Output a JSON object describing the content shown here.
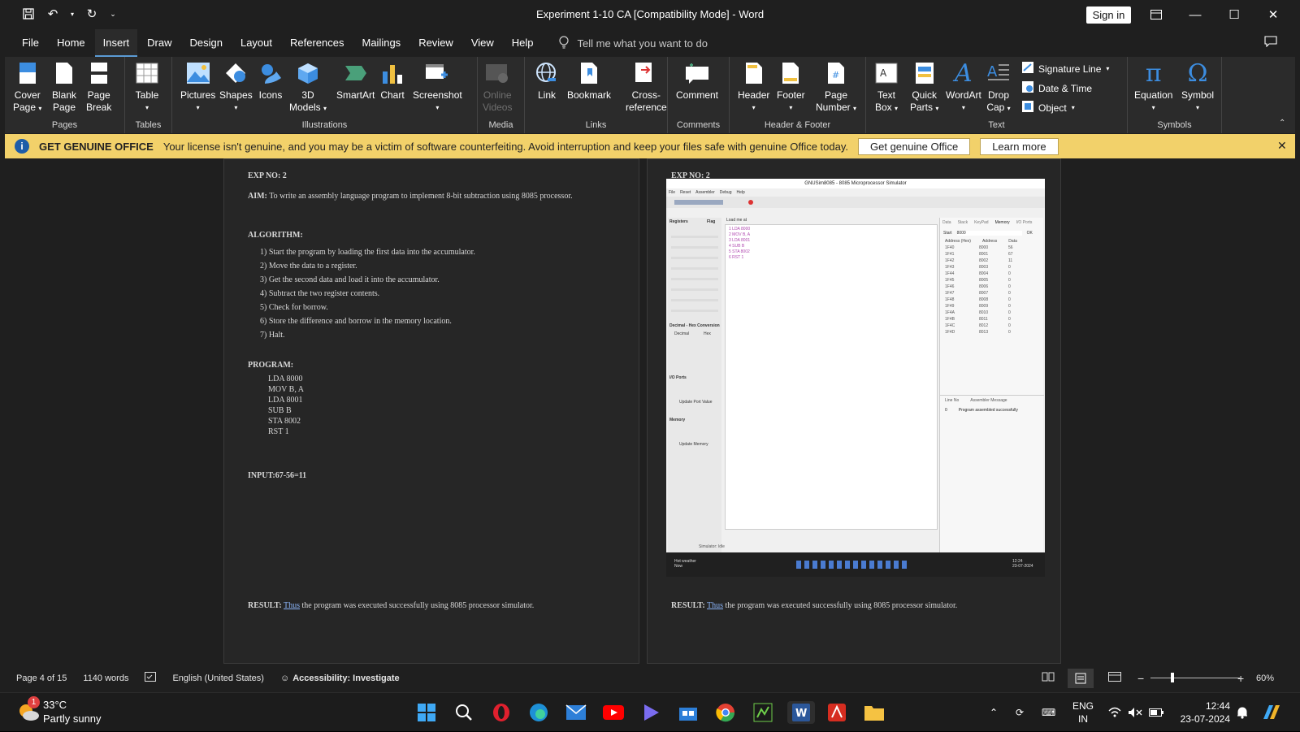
{
  "window": {
    "title": "Experiment 1-10 CA [Compatibility Mode]  -  Word",
    "sign_in": "Sign in"
  },
  "menu": {
    "tabs": [
      "File",
      "Home",
      "Insert",
      "Draw",
      "Design",
      "Layout",
      "References",
      "Mailings",
      "Review",
      "View",
      "Help"
    ],
    "active": "Insert",
    "tell_me": "Tell me what you want to do"
  },
  "ribbon": {
    "pages": {
      "label": "Pages",
      "cover": "Cover",
      "cover2": "Page",
      "blank": "Blank",
      "blank2": "Page",
      "break": "Page",
      "break2": "Break"
    },
    "tables": {
      "label": "Tables",
      "table": "Table"
    },
    "illustrations": {
      "label": "Illustrations",
      "pictures": "Pictures",
      "shapes": "Shapes",
      "icons": "Icons",
      "models": "3D",
      "models2": "Models",
      "smartart": "SmartArt",
      "chart": "Chart",
      "screenshot": "Screenshot"
    },
    "media": {
      "label": "Media",
      "online": "Online",
      "online2": "Videos"
    },
    "links": {
      "label": "Links",
      "link": "Link",
      "bookmark": "Bookmark",
      "cross": "Cross-",
      "cross2": "reference"
    },
    "comments": {
      "label": "Comments",
      "comment": "Comment"
    },
    "headerfooter": {
      "label": "Header & Footer",
      "header": "Header",
      "footer": "Footer",
      "pagenum": "Page",
      "pagenum2": "Number"
    },
    "text": {
      "label": "Text",
      "textbox": "Text",
      "textbox2": "Box",
      "quickparts": "Quick",
      "quickparts2": "Parts",
      "wordart": "WordArt",
      "dropcap": "Drop",
      "dropcap2": "Cap",
      "sigline": "Signature Line",
      "datetime": "Date & Time",
      "object": "Object"
    },
    "symbols": {
      "label": "Symbols",
      "equation": "Equation",
      "symbol": "Symbol"
    }
  },
  "infobar": {
    "title": "GET GENUINE OFFICE",
    "message": "Your license isn't genuine, and you may be a victim of software counterfeiting. Avoid interruption and keep your files safe with genuine Office today.",
    "btn_get": "Get genuine Office",
    "btn_learn": "Learn more"
  },
  "doc_left": {
    "exp": "EXP NO: 2",
    "aim_label": "AIM:",
    "aim": " To write an assembly language program to implement 8-bit subtraction using 8085 processor.",
    "algo_label": "ALGORITHM:",
    "steps": [
      "1)    Start the program by loading the first data into the accumulator.",
      "2)    Move the data to a register.",
      "3)    Get the second data and load it into the accumulator.",
      "4)    Subtract the two register contents.",
      "5)    Check for borrow.",
      "6)    Store the difference and borrow in the memory location.",
      "7)    Halt."
    ],
    "program_label": "PROGRAM:",
    "program": [
      "LDA 8000",
      "MOV B, A",
      "LDA 8001",
      "SUB B",
      "STA 8002",
      "RST 1"
    ],
    "input": "INPUT:67-56=11",
    "result_label": "RESULT:",
    "result_link": "Thus",
    "result": " the program was executed successfully using 8085 processor simulator."
  },
  "doc_right": {
    "exp": "EXP NO: 2",
    "result_label": "RESULT:",
    "result_link": "Thus",
    "result": " the program was executed successfully using 8085 processor simulator."
  },
  "sim": {
    "title": "GNUSim8085 - 8085 Microprocessor Simulator",
    "menu": [
      "File",
      "Reset",
      "Assembler",
      "Debug",
      "Help"
    ],
    "registers": "Registers",
    "flag": "Flag",
    "load_me_at": "Load me at",
    "code": [
      "1   LDA 8000",
      "2   MOV B, A",
      "3   LDA 8001",
      "4   SUB B",
      "5   STA 8002",
      "6   RST 1"
    ],
    "tabs": [
      "Data",
      "Stack",
      "KeyPad",
      "Memory",
      "I/O Ports"
    ],
    "start": "Start",
    "start_val": "8000",
    "ok": "OK",
    "mem_headers": [
      "Address (Hex)",
      "Address",
      "Data"
    ],
    "mem_rows": [
      [
        "1F40",
        "8000",
        "56"
      ],
      [
        "1F41",
        "8001",
        "67"
      ],
      [
        "1F42",
        "8002",
        "11"
      ],
      [
        "1F43",
        "8003",
        "0"
      ],
      [
        "1F44",
        "8004",
        "0"
      ],
      [
        "1F45",
        "8005",
        "0"
      ],
      [
        "1F46",
        "8006",
        "0"
      ],
      [
        "1F47",
        "8007",
        "0"
      ],
      [
        "1F48",
        "8008",
        "0"
      ],
      [
        "1F49",
        "8009",
        "0"
      ],
      [
        "1F4A",
        "8010",
        "0"
      ],
      [
        "1F4B",
        "8011",
        "0"
      ],
      [
        "1F4C",
        "8012",
        "0"
      ],
      [
        "1F4D",
        "8013",
        "0"
      ]
    ],
    "msg_headers": [
      "Line No",
      "Assembler Message"
    ],
    "msg": [
      "0",
      "Program assembled successfully"
    ],
    "dec_hex": "Decimal - Hex Conversion",
    "dec": "Decimal",
    "hex": "Hex",
    "io_ports": "I/O Ports",
    "update_port": "Update Port Value",
    "memory": "Memory",
    "update_memory": "Update Memory",
    "status": "Simulator: Idle",
    "weather": "Hot weather",
    "weather2": "Now",
    "time": "12:24",
    "date": "23-07-2024"
  },
  "status": {
    "page": "Page 4 of 15",
    "words": "1140 words",
    "language": "English (United States)",
    "accessibility": "Accessibility: Investigate",
    "zoom": "60%"
  },
  "taskbar": {
    "temp": "33°C",
    "weather": "Partly sunny",
    "badge": "1",
    "lang1": "ENG",
    "lang2": "IN",
    "time": "12:44",
    "date": "23-07-2024"
  }
}
